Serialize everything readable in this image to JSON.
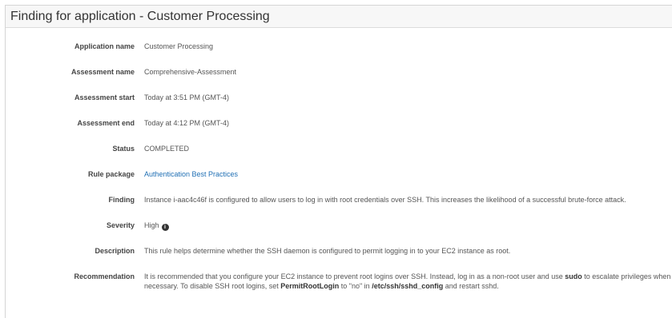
{
  "panel": {
    "title": "Finding for application - Customer Processing"
  },
  "details": {
    "application_name": {
      "label": "Application name",
      "value": "Customer Processing"
    },
    "assessment_name": {
      "label": "Assessment name",
      "value": "Comprehensive-Assessment"
    },
    "assessment_start": {
      "label": "Assessment start",
      "value": "Today at 3:51 PM (GMT-4)"
    },
    "assessment_end": {
      "label": "Assessment end",
      "value": "Today at 4:12 PM (GMT-4)"
    },
    "status": {
      "label": "Status",
      "value": "COMPLETED"
    },
    "rule_package": {
      "label": "Rule package",
      "value": "Authentication Best Practices"
    },
    "finding": {
      "label": "Finding",
      "value": "Instance i-aac4c46f is configured to allow users to log in with root credentials over SSH. This increases the likelihood of a successful brute-force attack."
    },
    "severity": {
      "label": "Severity",
      "value": "High",
      "icon": "info-icon"
    },
    "description": {
      "label": "Description",
      "value": "This rule helps determine whether the SSH daemon is configured to permit logging in to your EC2 instance as root."
    },
    "recommendation": {
      "label": "Recommendation",
      "text_1": "It is recommended that you configure your EC2 instance to prevent root logins over SSH. Instead, log in as a non-root user and use ",
      "bold_1": "sudo",
      "text_2": " to escalate privileges when necessary. To disable SSH root logins, set ",
      "bold_2": "PermitRootLogin",
      "text_3": " to \"no\" in ",
      "bold_3": "/etc/ssh/sshd_config",
      "text_4": " and restart sshd."
    }
  },
  "colors": {
    "link": "#1f6fb4",
    "header_background": "#f7f7f7",
    "border": "#d5d5d5"
  }
}
